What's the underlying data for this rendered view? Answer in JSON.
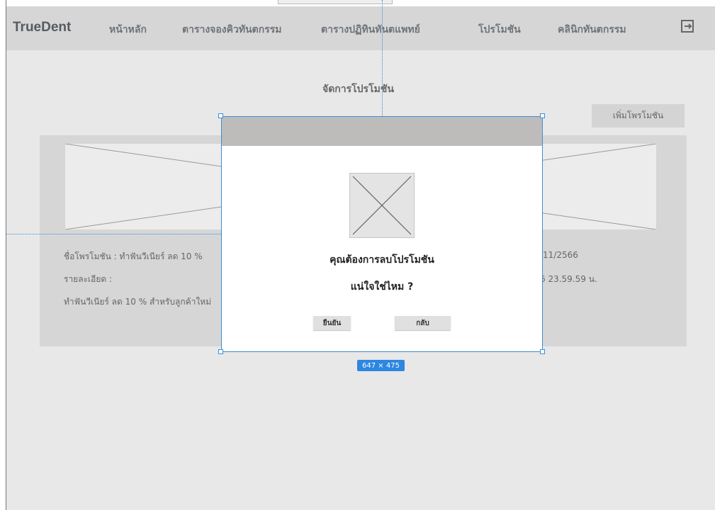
{
  "navbar": {
    "brand": "TrueDent",
    "items": [
      {
        "label": "หน้าหลัก"
      },
      {
        "label": "ตารางจองคิวทันตกรรม"
      },
      {
        "label": "ตารางปฏิทินทันตแพทย์"
      },
      {
        "label": "โปรโมชัน"
      },
      {
        "label": "คลินิกทันตกรรม"
      }
    ],
    "logout_icon": "logout-icon"
  },
  "page": {
    "title": "จัดการโปรโมชัน",
    "add_button": "เพิ่มโพรโมชัน"
  },
  "promotion": {
    "name_line": "ชื่อโพรโมชัน : ทำฟันวีเนียร์ ลด 10 %",
    "detail_label": "รายละเอียด :",
    "detail_text": "ทำฟันวีเนียร์ ลด 10 % สำหรับลูกค้าใหม่",
    "date_fragment": "/11/2566",
    "time_fragment": "6 23.59.59 น."
  },
  "dialog": {
    "image_icon": "image-placeholder-icon",
    "line1": "คุณต้องการลบโปรโมชัน",
    "line2": "แน่ใจใช่ไหม ?",
    "confirm": "ยืนยัน",
    "back": "กลับ"
  },
  "selection": {
    "dimensions": "647 × 475"
  },
  "colors": {
    "navbar": "#d6d6d6",
    "background": "#e8e8e8",
    "selection": "#3b8fd9"
  }
}
